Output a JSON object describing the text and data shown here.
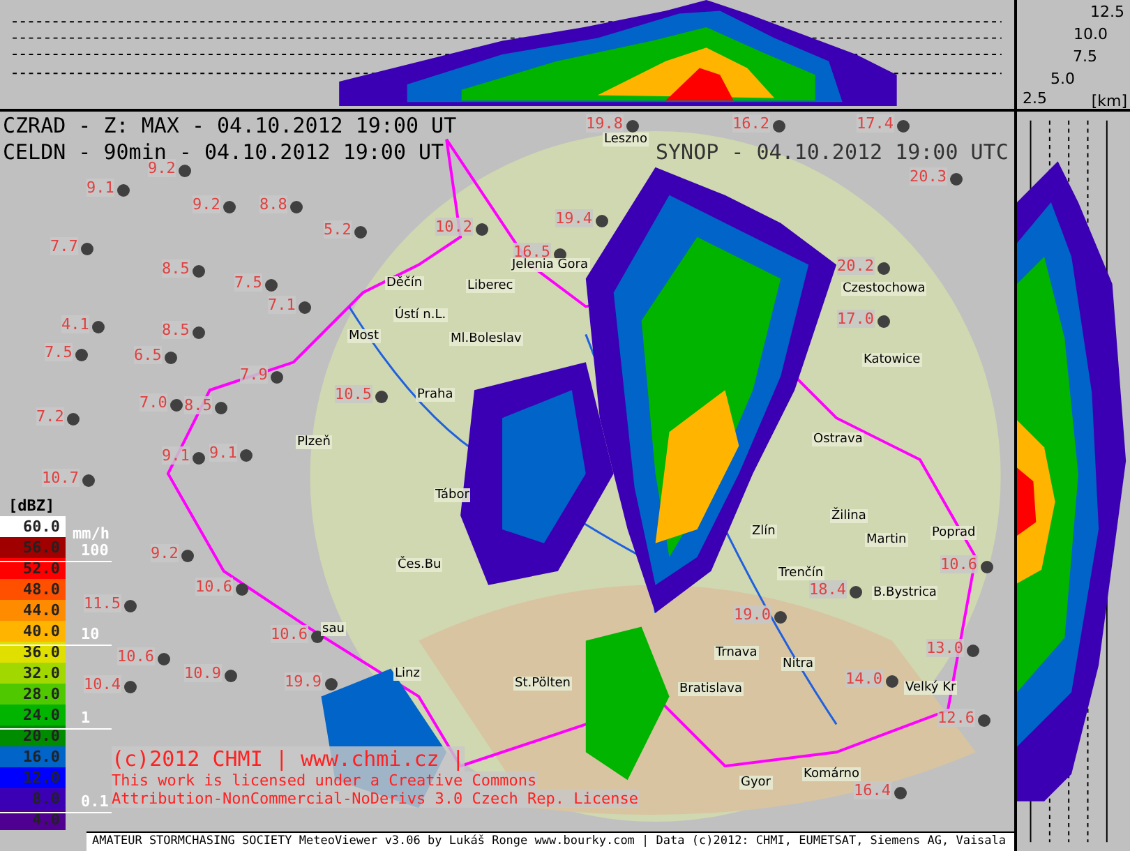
{
  "height_scale": {
    "ticks": [
      "12.5",
      "10.0",
      "7.5",
      "5.0",
      "2.5"
    ],
    "unit": "[km]"
  },
  "header": {
    "line_1": "CZRAD - Z: MAX - 04.10.2012 19:00 UT",
    "line_2": "CELDN - 90min - 04.10.2012 19:00 UT",
    "synop": "SYNOP - 04.10.2012 19:00 UTC"
  },
  "legend": {
    "unit": "[dBZ]",
    "rain_unit": "mm/h",
    "rain_marks": [
      "100",
      "10",
      "1",
      "0.1"
    ],
    "levels": [
      {
        "label": "60.0",
        "color": "#ffffff"
      },
      {
        "label": "56.0",
        "color": "#a00000"
      },
      {
        "label": "52.0",
        "color": "#ff0000"
      },
      {
        "label": "48.0",
        "color": "#ff5000"
      },
      {
        "label": "44.0",
        "color": "#ff8c00"
      },
      {
        "label": "40.0",
        "color": "#ffb400"
      },
      {
        "label": "36.0",
        "color": "#e0e000"
      },
      {
        "label": "32.0",
        "color": "#a0d800"
      },
      {
        "label": "28.0",
        "color": "#50c800"
      },
      {
        "label": "24.0",
        "color": "#00b400"
      },
      {
        "label": "20.0",
        "color": "#008c00"
      },
      {
        "label": "16.0",
        "color": "#0064c8"
      },
      {
        "label": "12.0",
        "color": "#0000ff"
      },
      {
        "label": "8.0",
        "color": "#3c00b4"
      },
      {
        "label": "4.0",
        "color": "#500090"
      }
    ]
  },
  "cities": [
    "Leszno",
    "Jelenia Gora",
    "Děčín",
    "Liberec",
    "Ústí n.L.",
    "Most",
    "Ml.Boleslav",
    "Praha",
    "Plzeň",
    "Tábor",
    "Čes.Bu",
    "Zlín",
    "Ostrava",
    "Czestochowa",
    "Katowice",
    "Žilina",
    "Martin",
    "Poprad",
    "Trenčín",
    "B.Bystrica",
    "Trnava",
    "Nitra",
    "Velký Kr",
    "Komárno",
    "Gyor",
    "Bratislava",
    "St.Pölten",
    "Linz",
    "sau"
  ],
  "stations": [
    "19.8",
    "16.2",
    "17.4",
    "20.3",
    "9.1",
    "9.2",
    "9.2",
    "8.8",
    "5.2",
    "10.2",
    "19.4",
    "16.5",
    "7.7",
    "8.5",
    "7.5",
    "7.1",
    "4.1",
    "8.5",
    "6.5",
    "7.5",
    "7.9",
    "17.0",
    "20.2",
    "7.2",
    "7.0",
    "8.5",
    "10.5",
    "9.1",
    "9.1",
    "10.7",
    "9.2",
    "10.6",
    "11.5",
    "10.6",
    "10.4",
    "10.9",
    "10.6",
    "19.9",
    "19.0",
    "18.4",
    "13.0",
    "14.0",
    "12.6",
    "16.4",
    "10.6"
  ],
  "copyright": {
    "line_1": "(c)2012 CHMI | www.chmi.cz |",
    "line_2": "This work is licensed under a Creative Commons",
    "line_3": "Attribution-NonCommercial-NoDerivs 3.0 Czech Rep. License"
  },
  "footer": "AMATEUR STORMCHASING SOCIETY MeteoViewer v3.06 by Lukáš Ronge www.bourky.com | Data (c)2012: CHMI, EUMETSAT, Siemens AG, Vaisala"
}
